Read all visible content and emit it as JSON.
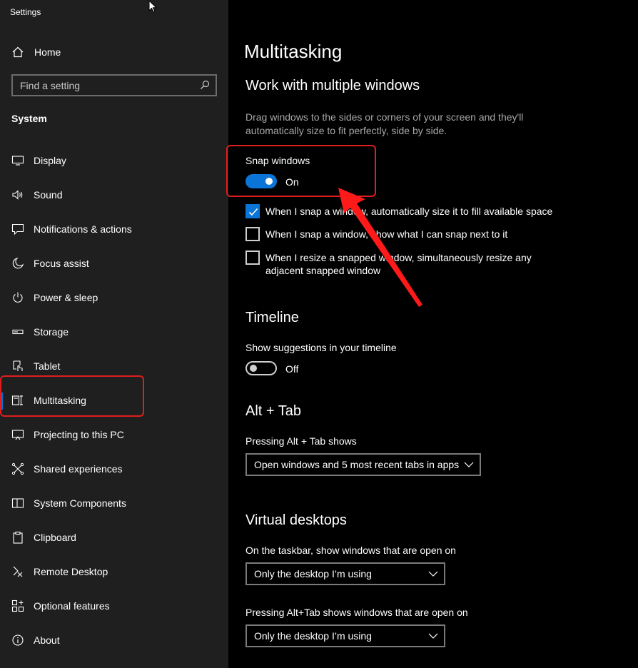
{
  "app": {
    "title": "Settings"
  },
  "sidebar": {
    "home_label": "Home",
    "search_placeholder": "Find a setting",
    "section": "System",
    "items": [
      {
        "label": "Display",
        "icon": "display-icon"
      },
      {
        "label": "Sound",
        "icon": "sound-icon"
      },
      {
        "label": "Notifications & actions",
        "icon": "notifications-icon"
      },
      {
        "label": "Focus assist",
        "icon": "moon-icon"
      },
      {
        "label": "Power & sleep",
        "icon": "power-icon"
      },
      {
        "label": "Storage",
        "icon": "storage-icon"
      },
      {
        "label": "Tablet",
        "icon": "tablet-icon"
      },
      {
        "label": "Multitasking",
        "icon": "multitasking-icon",
        "active": true
      },
      {
        "label": "Projecting to this PC",
        "icon": "projecting-icon"
      },
      {
        "label": "Shared experiences",
        "icon": "shared-icon"
      },
      {
        "label": "System Components",
        "icon": "components-icon"
      },
      {
        "label": "Clipboard",
        "icon": "clipboard-icon"
      },
      {
        "label": "Remote Desktop",
        "icon": "remote-desktop-icon"
      },
      {
        "label": "Optional features",
        "icon": "optional-features-icon"
      },
      {
        "label": "About",
        "icon": "info-icon"
      }
    ]
  },
  "main": {
    "title": "Multitasking",
    "snap": {
      "heading": "Work with multiple windows",
      "description": "Drag windows to the sides or corners of your screen and they'll automatically size to fit perfectly, side by side.",
      "toggle_label": "Snap windows",
      "toggle_state": "On",
      "options": [
        {
          "text": "When I snap a window, automatically size it to fill available space",
          "checked": true
        },
        {
          "text": "When I snap a window, show what I can snap next to it",
          "checked": false
        },
        {
          "text": "When I resize a snapped window, simultaneously resize any adjacent snapped window",
          "checked": false
        }
      ]
    },
    "timeline": {
      "heading": "Timeline",
      "toggle_label": "Show suggestions in your timeline",
      "toggle_state": "Off"
    },
    "alttab": {
      "heading": "Alt + Tab",
      "label": "Pressing Alt + Tab shows",
      "value": "Open windows and 5 most recent tabs in apps"
    },
    "virtual": {
      "heading": "Virtual desktops",
      "taskbar_label": "On the taskbar, show windows that are open on",
      "taskbar_value": "Only the desktop I’m using",
      "alttab_label": "Pressing Alt+Tab shows windows that are open on",
      "alttab_value": "Only the desktop I’m using"
    }
  },
  "colors": {
    "accent": "#0a74d9",
    "annotation": "#e01d1d",
    "sidebar_bg": "#1f1f1f",
    "main_bg": "#000000"
  }
}
